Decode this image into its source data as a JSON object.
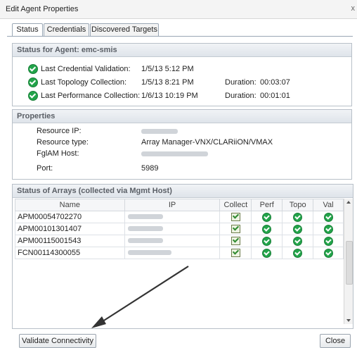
{
  "window": {
    "title": "Edit Agent Properties",
    "close_glyph": "x"
  },
  "tabs": [
    {
      "label": "Status",
      "active": true
    },
    {
      "label": "Credentials",
      "active": false
    },
    {
      "label": "Discovered Targets",
      "active": false
    }
  ],
  "status_panel": {
    "title": "Status for Agent: emc-smis",
    "rows": [
      {
        "label": "Last Credential Validation:",
        "value": "1/5/13 5:12 PM",
        "duration_label": "",
        "duration": ""
      },
      {
        "label": "Last Topology Collection:",
        "value": "1/5/13 8:21 PM",
        "duration_label": "Duration:",
        "duration": "00:03:07"
      },
      {
        "label": "Last Performance Collection:",
        "value": "1/6/13 10:19 PM",
        "duration_label": "Duration:",
        "duration": "00:01:01"
      }
    ]
  },
  "properties_panel": {
    "title": "Properties",
    "rows": [
      {
        "label": "Resource IP:",
        "value": ""
      },
      {
        "label": "Resource type:",
        "value": "Array Manager-VNX/CLARiiON/VMAX"
      },
      {
        "label": "FglAM Host:",
        "value": ""
      },
      {
        "label": "Port:",
        "value": "5989"
      }
    ]
  },
  "arrays_panel": {
    "title": "Status of Arrays (collected via Mgmt Host)",
    "columns": [
      "Name",
      "IP",
      "Collect",
      "Perf",
      "Topo",
      "Val"
    ],
    "rows": [
      {
        "name": "APM00054702270"
      },
      {
        "name": "APM00101301407"
      },
      {
        "name": "APM00115001543"
      },
      {
        "name": "FCN00114300055"
      }
    ]
  },
  "buttons": {
    "validate": "Validate Connectivity",
    "close": "Close"
  },
  "colors": {
    "ok_green": "#22a44a",
    "panel_header_text": "#5a5f66"
  }
}
